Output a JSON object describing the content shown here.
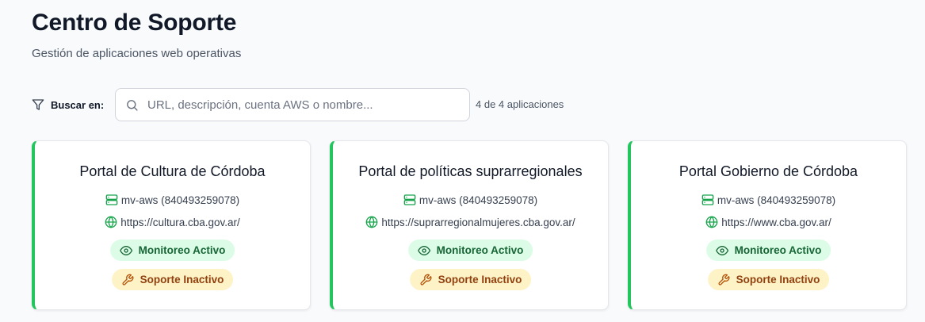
{
  "header": {
    "title": "Centro de Soporte",
    "subtitle": "Gestión de aplicaciones web operativas"
  },
  "filter": {
    "label": "Buscar en:",
    "placeholder": "URL, descripción, cuenta AWS o nombre...",
    "value": "",
    "count_text": "4 de 4 aplicaciones"
  },
  "colors": {
    "accent_green": "#22c55e",
    "monitor_bg": "#dcfce7",
    "monitor_text": "#166534",
    "support_bg": "#fef3c7",
    "support_text": "#92400e"
  },
  "apps": [
    {
      "name": "Portal de Cultura de Córdoba",
      "account": "mv-aws (840493259078)",
      "url": "https://cultura.cba.gov.ar/",
      "monitoring": "Monitoreo Activo",
      "support": "Soporte Inactivo"
    },
    {
      "name": "Portal de políticas suprarregionales",
      "account": "mv-aws (840493259078)",
      "url": "https://suprarregionalmujeres.cba.gov.ar/",
      "monitoring": "Monitoreo Activo",
      "support": "Soporte Inactivo"
    },
    {
      "name": "Portal Gobierno de Córdoba",
      "account": "mv-aws (840493259078)",
      "url": "https://www.cba.gov.ar/",
      "monitoring": "Monitoreo Activo",
      "support": "Soporte Inactivo"
    }
  ],
  "icons": {
    "filter": "filter-icon",
    "search": "search-icon",
    "account": "server-icon",
    "url": "globe-icon",
    "monitoring": "eye-icon",
    "support": "wrench-icon"
  }
}
